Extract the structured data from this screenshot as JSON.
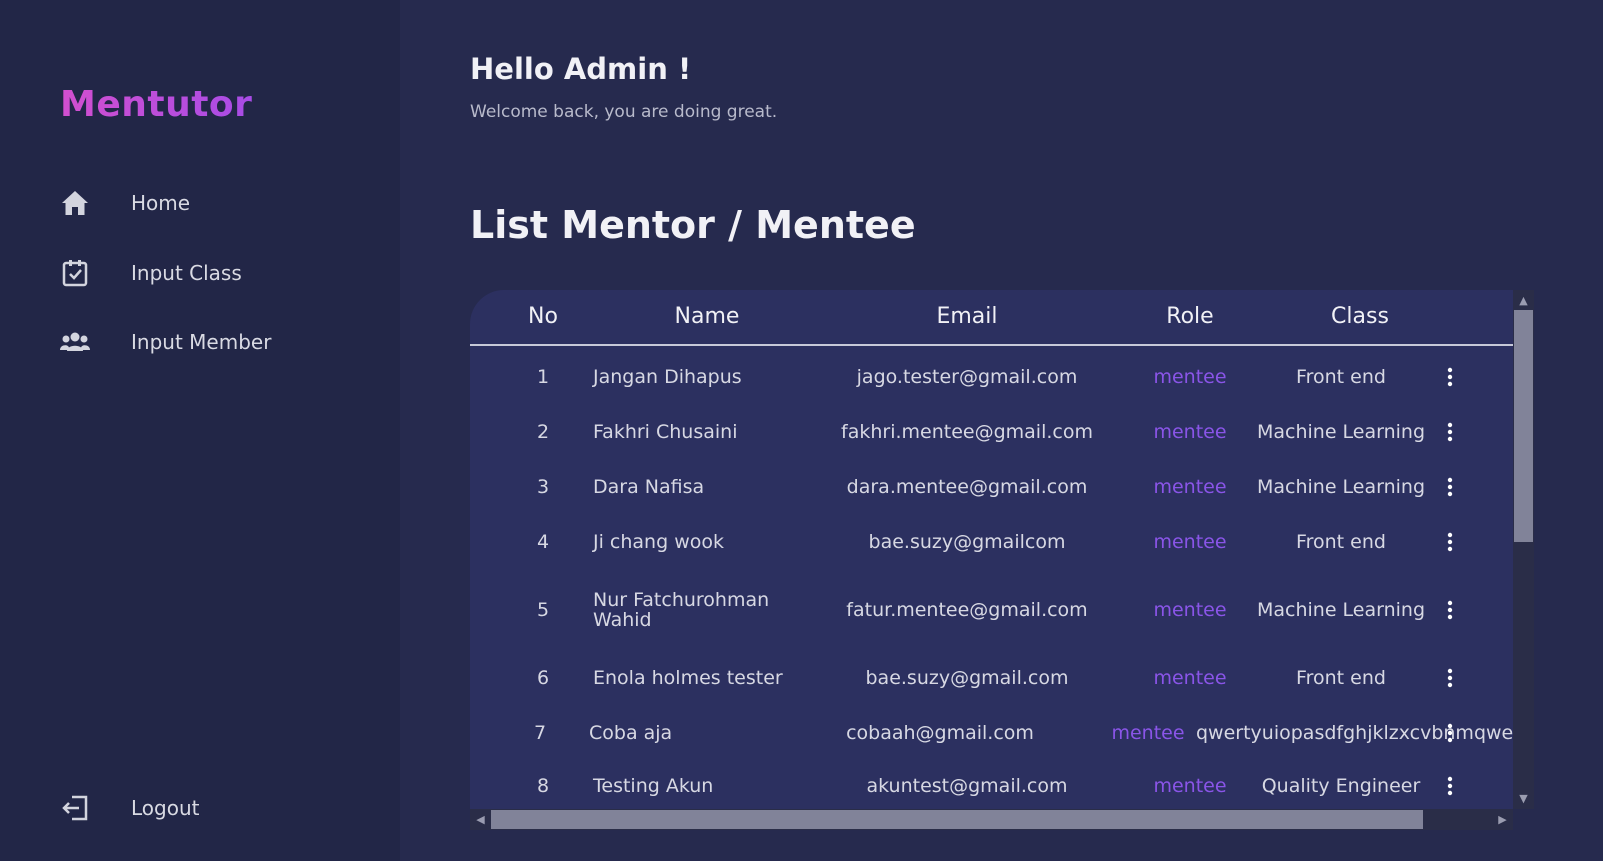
{
  "brand": "Mentutor",
  "nav": {
    "home": {
      "label": "Home",
      "icon": "home-icon"
    },
    "input_class": {
      "label": "Input Class",
      "icon": "calendar-check-icon"
    },
    "input_member": {
      "label": "Input Member",
      "icon": "users-icon"
    },
    "logout": {
      "label": "Logout",
      "icon": "logout-icon"
    }
  },
  "header": {
    "greeting": "Hello Admin !",
    "subtitle": "Welcome back, you are doing great."
  },
  "list": {
    "title": "List Mentor / Mentee",
    "columns": {
      "no": "No",
      "name": "Name",
      "email": "Email",
      "role": "Role",
      "class": "Class"
    },
    "rows": [
      {
        "no": "1",
        "name": "Jangan Dihapus",
        "email": "jago.tester@gmail.com",
        "role": "mentee",
        "class": "Front end"
      },
      {
        "no": "2",
        "name": "Fakhri Chusaini",
        "email": "fakhri.mentee@gmail.com",
        "role": "mentee",
        "class": "Machine Learning"
      },
      {
        "no": "3",
        "name": "Dara Nafisa",
        "email": "dara.mentee@gmail.com",
        "role": "mentee",
        "class": "Machine Learning"
      },
      {
        "no": "4",
        "name": "Ji chang wook",
        "email": "bae.suzy@gmailcom",
        "role": "mentee",
        "class": "Front end"
      },
      {
        "no": "5",
        "name": "Nur Fatchurohman Wahid",
        "email": "fatur.mentee@gmail.com",
        "role": "mentee",
        "class": "Machine Learning"
      },
      {
        "no": "6",
        "name": "Enola holmes tester",
        "email": "bae.suzy@gmail.com",
        "role": "mentee",
        "class": "Front end"
      },
      {
        "no": "7",
        "name": "Coba aja",
        "email": "cobaah@gmail.com",
        "role": "mentee",
        "class": "qwertyuiopasdfghjklzxcvbnmqwe"
      },
      {
        "no": "8",
        "name": "Testing Akun",
        "email": "akuntest@gmail.com",
        "role": "mentee",
        "class": "Quality Engineer"
      }
    ]
  },
  "colors": {
    "background": "#262a4e",
    "sidebar": "#222647",
    "table": "#2c3060",
    "brand_gradient_start": "#d24fcf",
    "brand_gradient_end": "#a84ce6",
    "role": "#8a55e8"
  }
}
